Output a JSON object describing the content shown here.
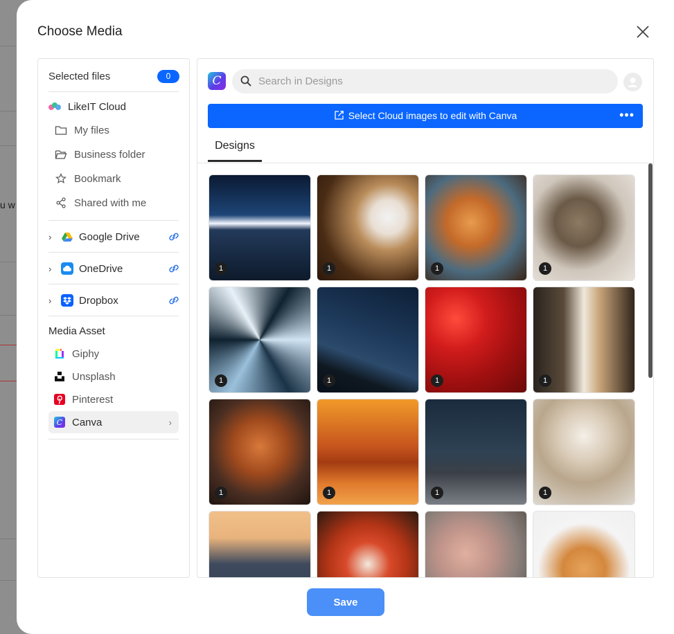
{
  "modal": {
    "title": "Choose Media",
    "save_label": "Save",
    "close_icon": "close-icon"
  },
  "backdrop": {
    "peek_text": "u w"
  },
  "sidebar": {
    "selected_files_label": "Selected files",
    "selected_count": "0",
    "cloud": {
      "title": "LikeIT Cloud",
      "items": [
        {
          "label": "My files",
          "icon": "folder-icon"
        },
        {
          "label": "Business folder",
          "icon": "folder-open-icon"
        },
        {
          "label": "Bookmark",
          "icon": "star-icon"
        },
        {
          "label": "Shared with me",
          "icon": "share-icon"
        }
      ]
    },
    "providers": [
      {
        "label": "Google Drive",
        "icon": "google-drive-icon"
      },
      {
        "label": "OneDrive",
        "icon": "onedrive-icon"
      },
      {
        "label": "Dropbox",
        "icon": "dropbox-icon"
      }
    ],
    "media_asset_title": "Media Asset",
    "assets": [
      {
        "label": "Giphy",
        "icon": "giphy-icon"
      },
      {
        "label": "Unsplash",
        "icon": "unsplash-icon"
      },
      {
        "label": "Pinterest",
        "icon": "pinterest-icon"
      },
      {
        "label": "Canva",
        "icon": "canva-icon",
        "active": true
      }
    ]
  },
  "canva": {
    "logo_letter": "C",
    "search_placeholder": "Search in Designs",
    "banner_text": "Select Cloud images to edit with Canva",
    "banner_more": "•••",
    "tabs": [
      {
        "label": "Designs",
        "active": true
      }
    ]
  },
  "tiles": [
    {
      "subject": "mountain sunset lake",
      "count": "1"
    },
    {
      "subject": "cat being petted",
      "count": "1"
    },
    {
      "subject": "orange cat",
      "count": "1"
    },
    {
      "subject": "tabby cat in arms",
      "count": "1"
    },
    {
      "subject": "spiral staircase",
      "count": "1"
    },
    {
      "subject": "milky way night sky",
      "count": "1"
    },
    {
      "subject": "red apples",
      "count": "1"
    },
    {
      "subject": "narrow alley",
      "count": "1"
    },
    {
      "subject": "red fox",
      "count": "1"
    },
    {
      "subject": "orange mountain clouds",
      "count": "1"
    },
    {
      "subject": "star trails",
      "count": "1"
    },
    {
      "subject": "happy cat",
      "count": "1"
    },
    {
      "subject": "misty hills sunset",
      "count": ""
    },
    {
      "subject": "pizza",
      "count": ""
    },
    {
      "subject": "sleeping puppy",
      "count": ""
    },
    {
      "subject": "shiba inu",
      "count": ""
    }
  ],
  "colors": {
    "accent": "#0a66ff",
    "save": "#4b8ff8",
    "badge": "#1e1e1e"
  }
}
